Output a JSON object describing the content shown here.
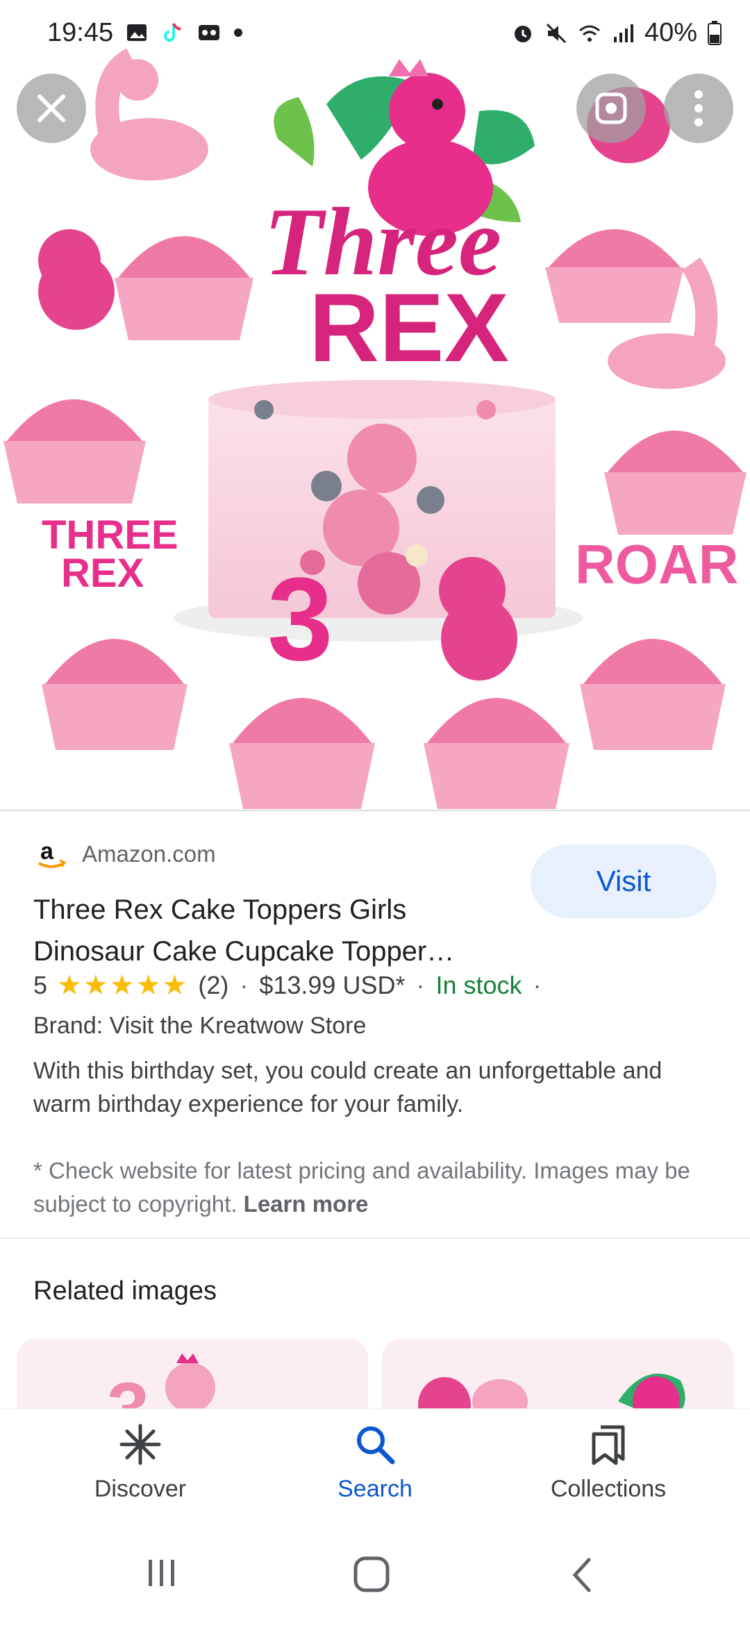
{
  "status_bar": {
    "time": "19:45",
    "battery": "40%"
  },
  "hero": {
    "topper_title_1": "Three",
    "topper_title_2": "REX",
    "small_topper_1_line1": "THREE",
    "small_topper_1_line2": "REX",
    "small_topper_2": "ROAR",
    "number_topper": "3",
    "close_icon": "close-icon",
    "lens_icon": "lens-icon",
    "more_icon": "more-vert-icon"
  },
  "result": {
    "source": "Amazon.com",
    "visit_label": "Visit",
    "title": "Three Rex Cake Toppers Girls Dinosaur Cake Cupcake Topper…",
    "rating": "5",
    "stars": "★★★★★",
    "reviews": "(2)",
    "price": "$13.99 USD*",
    "availability": "In stock",
    "brand": "Brand: Visit the Kreatwow Store",
    "description": "With this birthday set, you could create an unforgettable and warm birthday experience for your family.",
    "note": "* Check website for latest pricing and availability. Images may be subject to copyright.",
    "learn_more": "Learn more"
  },
  "related": {
    "title": "Related images"
  },
  "bottom_nav": {
    "items": [
      {
        "label": "Discover",
        "icon": "asterisk-icon"
      },
      {
        "label": "Search",
        "icon": "search-icon"
      },
      {
        "label": "Collections",
        "icon": "bookmarks-icon"
      }
    ]
  },
  "colors": {
    "accent_blue": "#0b57d0",
    "visit_bg": "#e8f0fe",
    "in_stock_green": "#188038",
    "star_yellow": "#fbbc04",
    "topper_pink": "#e62e8a"
  }
}
